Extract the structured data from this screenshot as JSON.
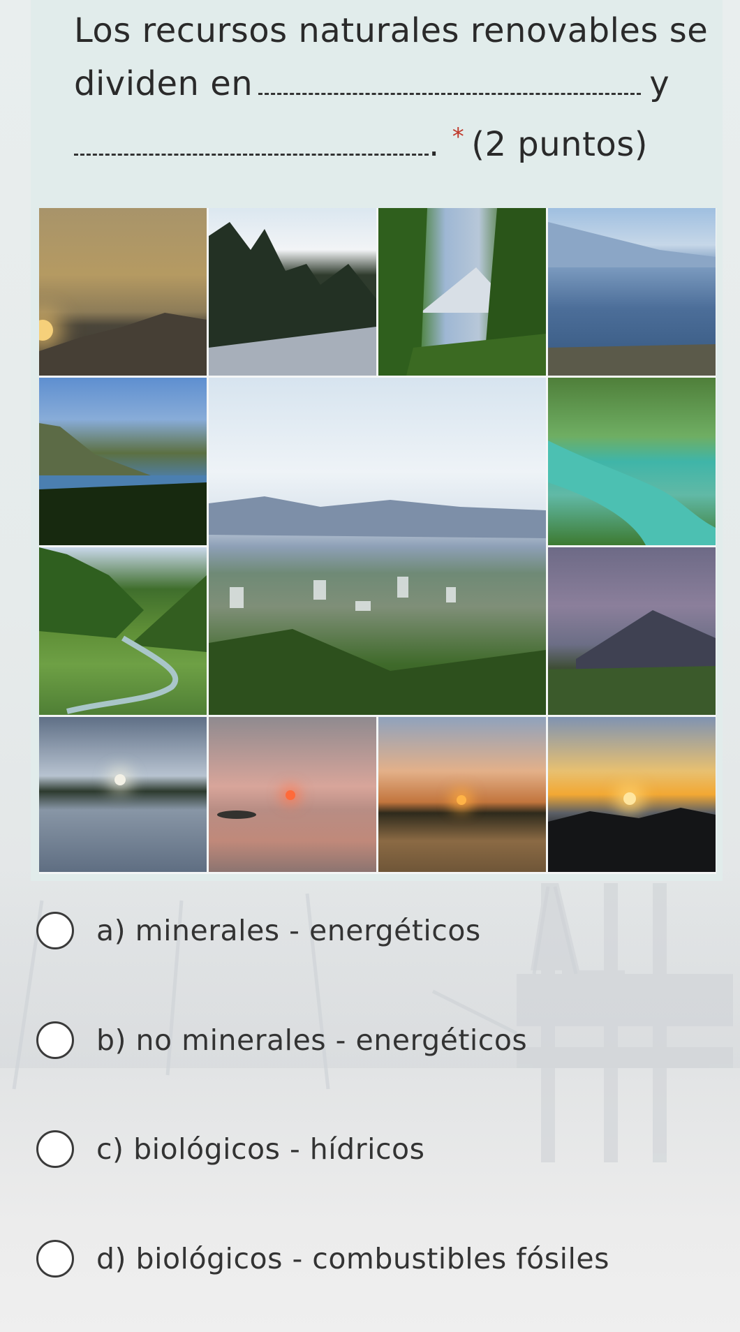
{
  "question": {
    "line1": "Los recursos naturales renovables se",
    "line2_prefix": "dividen en",
    "line2_suffix": "y",
    "required_mark": "*",
    "points": "(2 puntos)",
    "line3_end": "."
  },
  "collage": {
    "photos": [
      "sunset-mountains",
      "pine-trees-road",
      "volcano-through-trees",
      "lake-and-mountains",
      "volcano-and-lake",
      "city-valley-panorama",
      "turquoise-river-pools",
      "green-river-valley",
      "volcano-at-dusk",
      "lake-sunset-clouds",
      "orange-sun-over-water",
      "sunset-palms-water",
      "golden-sunset-mountains"
    ]
  },
  "options": [
    {
      "label": "a) minerales - energéticos",
      "selected": false
    },
    {
      "label": "b) no minerales - energéticos",
      "selected": false
    },
    {
      "label": "c) biológicos - hídricos",
      "selected": false
    },
    {
      "label": "d) biológicos - combustibles fósiles",
      "selected": false
    }
  ],
  "colors": {
    "card_background": "#e1eceb",
    "required": "#c0392b",
    "text": "#333333"
  }
}
